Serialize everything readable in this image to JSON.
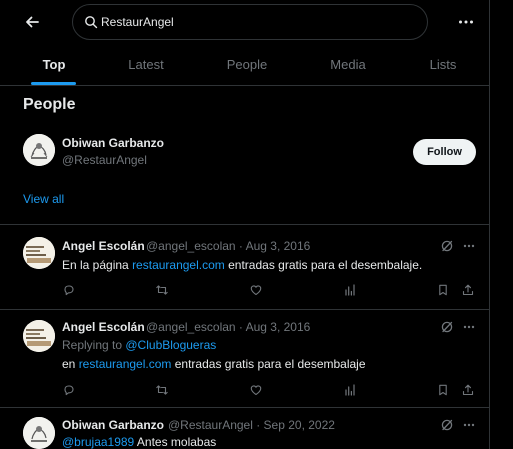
{
  "search": {
    "query": "RestaurAngel"
  },
  "tabs": [
    "Top",
    "Latest",
    "People",
    "Media",
    "Lists"
  ],
  "people": {
    "title": "People",
    "user": {
      "name": "Obiwan Garbanzo",
      "handle": "@RestaurAngel",
      "follow_label": "Follow"
    },
    "view_all": "View all"
  },
  "tweets": [
    {
      "name": "Angel Escolán",
      "meta": "@angel_escolan · Aug 3, 2016",
      "text_before": "En la página ",
      "link": "restaurangel.com",
      "text_after": " entradas gratis para el desembalaje."
    },
    {
      "name": "Angel Escolán",
      "meta": "@angel_escolan · Aug 3, 2016",
      "reply_prefix": "Replying to ",
      "reply_handle": "@ClubBlogueras",
      "text_before": "en ",
      "link": "restaurangel.com",
      "text_after": " entradas gratis para el desembalaje"
    },
    {
      "name": "Obiwan Garbanzo",
      "meta": "@RestaurAngel · Sep 20, 2022",
      "mention": "@brujaa1989",
      "text_after": " Antes molabas"
    }
  ],
  "colors": {
    "accent": "#1d9bf0",
    "text": "#e7e9ea",
    "muted": "#71767b",
    "border": "#2f3336",
    "background": "#000000"
  },
  "icons": [
    "back-arrow-icon",
    "search-icon",
    "more-icon",
    "grok-icon",
    "reply-icon",
    "retweet-icon",
    "like-icon",
    "views-icon",
    "bookmark-icon",
    "share-icon"
  ]
}
